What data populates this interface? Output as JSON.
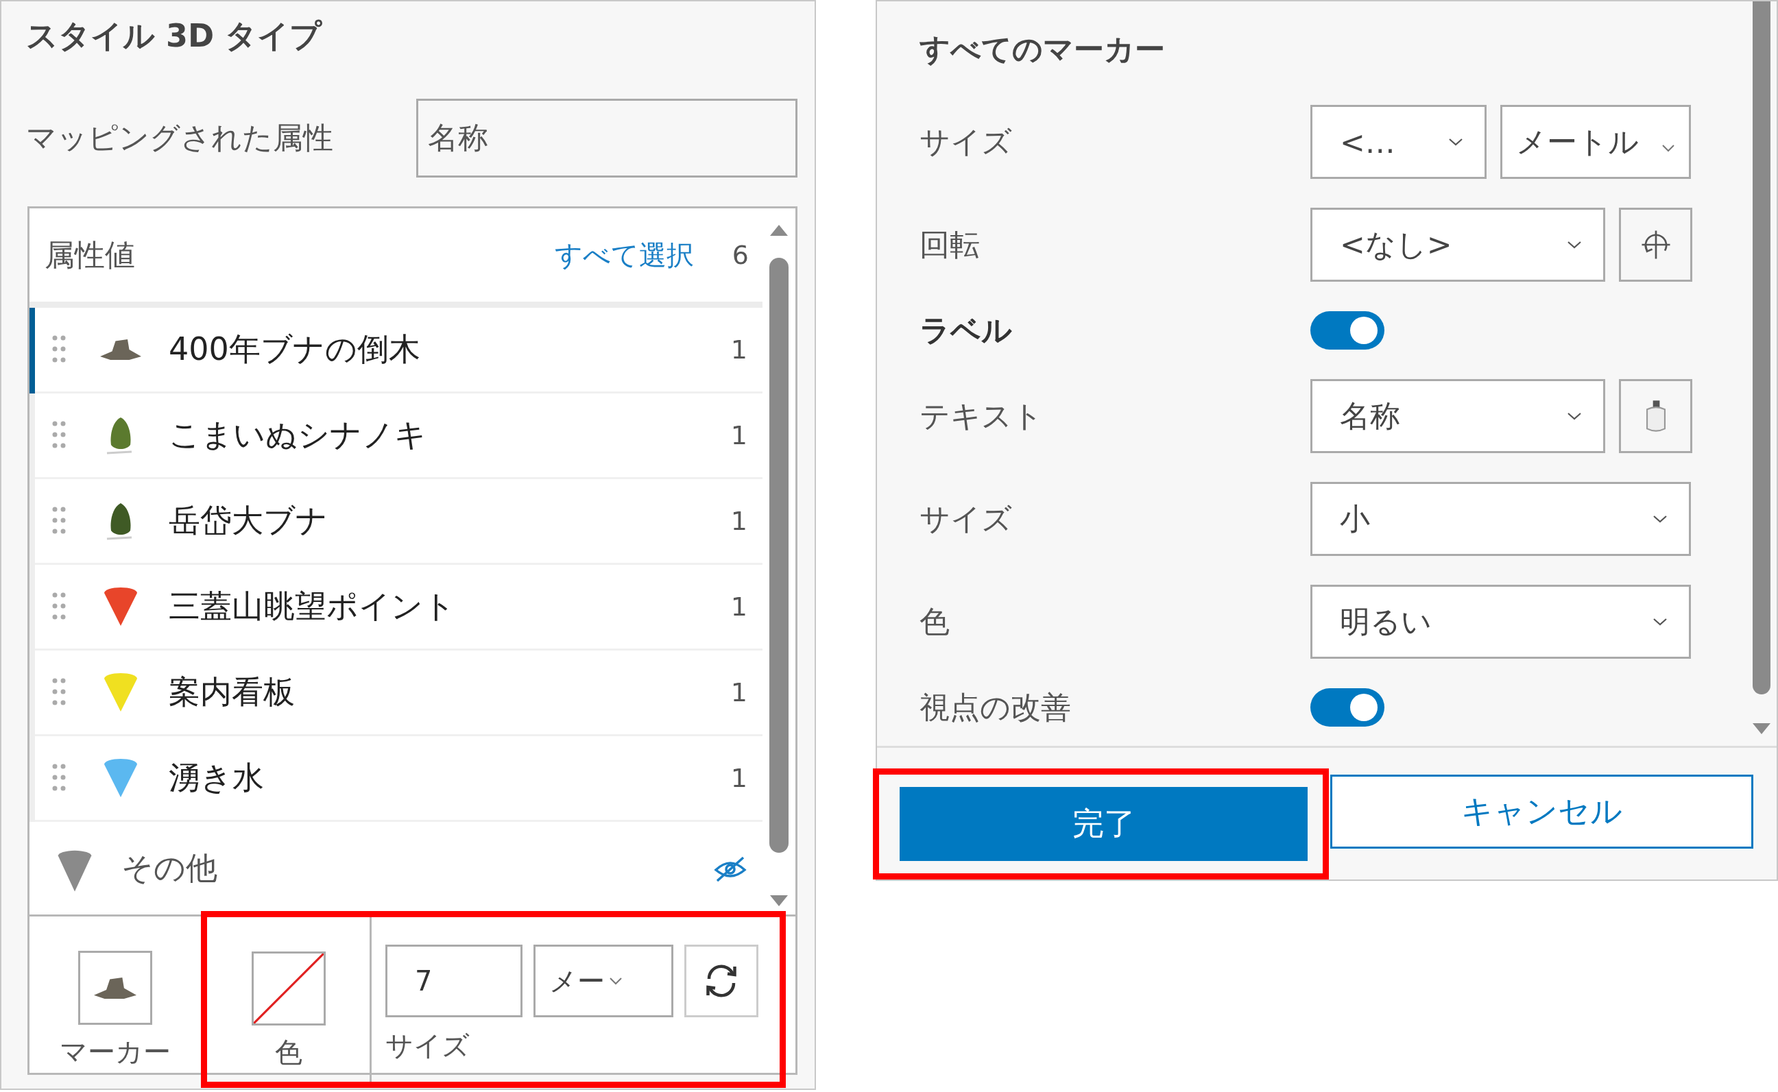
{
  "style_panel": {
    "title": "スタイル 3D タイプ",
    "mapped_attribute": {
      "label": "マッピングされた属性",
      "value": "名称"
    },
    "value_list": {
      "header": "属性値",
      "select_all": "すべて選択",
      "count": "6",
      "items": [
        {
          "label": "400年ブナの倒木",
          "count": "1",
          "kind": "log",
          "color": "#6b6559",
          "selected": true
        },
        {
          "label": "こまいぬシナノキ",
          "count": "1",
          "kind": "tree",
          "color": "#5b7a2e",
          "selected": false
        },
        {
          "label": "岳岱大ブナ",
          "count": "1",
          "kind": "tree",
          "color": "#3f5a25",
          "selected": false
        },
        {
          "label": "三蓋山眺望ポイント",
          "count": "1",
          "kind": "cone",
          "color": "#e8452a",
          "selected": false
        },
        {
          "label": "案内看板",
          "count": "1",
          "kind": "cone",
          "color": "#f0e020",
          "selected": false
        },
        {
          "label": "湧き水",
          "count": "1",
          "kind": "cone",
          "color": "#5bb8f0",
          "selected": false
        }
      ],
      "other": {
        "label": "その他",
        "visible": false
      }
    },
    "symbol_bar": {
      "marker_label": "マーカー",
      "color_label": "色",
      "size_label": "サイズ",
      "size_value": "7",
      "size_unit": "メー"
    }
  },
  "marker_panel": {
    "title": "すべてのマーカー",
    "rows": [
      {
        "kind": "select-pair",
        "label": "サイズ",
        "value": "<…",
        "unit": "メートル"
      },
      {
        "kind": "select-rotation",
        "label": "回転",
        "value": "<なし>"
      },
      {
        "kind": "section-toggle",
        "label": "ラベル",
        "on": true
      },
      {
        "kind": "select-expression",
        "label": "テキスト",
        "value": "名称"
      },
      {
        "kind": "select",
        "label": "サイズ",
        "value": "小"
      },
      {
        "kind": "select",
        "label": "色",
        "value": "明るい"
      },
      {
        "kind": "toggle",
        "label": "視点の改善",
        "on": true
      }
    ],
    "buttons": [
      {
        "label": "完了",
        "primary": true
      },
      {
        "label": "キャンセル",
        "primary": false
      }
    ]
  }
}
